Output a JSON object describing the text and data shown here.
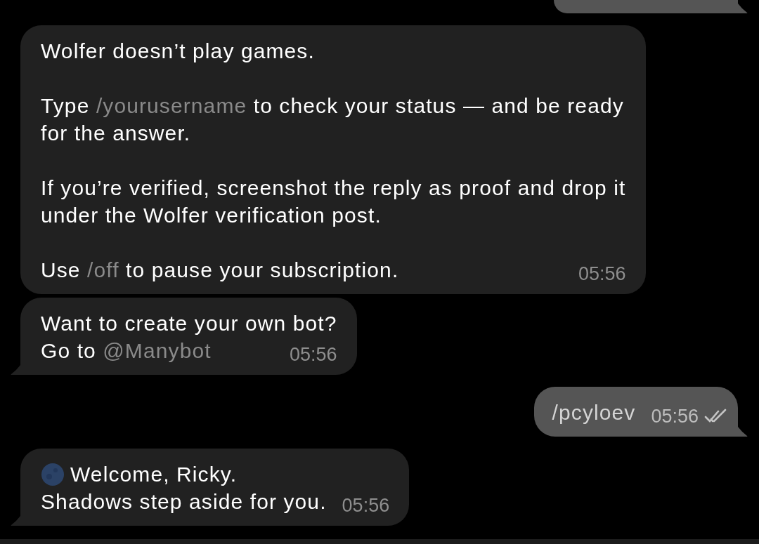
{
  "messages": [
    {
      "outgoing": true,
      "tail": true,
      "cut": true
    },
    {
      "outgoing": false,
      "tail": false,
      "time": "05:56",
      "paragraphs": [
        [
          [
            {
              "kind": "text",
              "text": "Wolfer doesn’t play games."
            }
          ]
        ],
        [
          [
            {
              "kind": "text",
              "text": "Type "
            },
            {
              "kind": "command",
              "text": "/yourusername"
            },
            {
              "kind": "text",
              "text": " to check your status — and be ready"
            }
          ],
          [
            {
              "kind": "text",
              "text": "for the answer."
            }
          ]
        ],
        [
          [
            {
              "kind": "text",
              "text": "If you’re verified, screenshot the reply as proof and drop it"
            }
          ],
          [
            {
              "kind": "text",
              "text": "under the Wolfer verification post."
            }
          ]
        ],
        [
          [
            {
              "kind": "text",
              "text": "Use "
            },
            {
              "kind": "command",
              "text": "/off"
            },
            {
              "kind": "text",
              "text": " to pause your subscription."
            }
          ]
        ]
      ]
    },
    {
      "outgoing": false,
      "tail": true,
      "time": "05:56",
      "paragraphs": [
        [
          [
            {
              "kind": "text",
              "text": "Want to create your own bot?"
            }
          ],
          [
            {
              "kind": "text",
              "text": "Go to "
            },
            {
              "kind": "command",
              "text": "@Manybot"
            }
          ]
        ]
      ]
    },
    {
      "outgoing": true,
      "tail": true,
      "time": "05:56",
      "read": true,
      "paragraphs": [
        [
          [
            {
              "kind": "text",
              "text": "/pcyloev"
            }
          ]
        ]
      ]
    },
    {
      "outgoing": false,
      "tail": true,
      "time": "05:56",
      "paragraphs": [
        [
          [
            {
              "kind": "emoji"
            },
            {
              "kind": "text",
              "text": "Welcome, Ricky."
            }
          ],
          [
            {
              "kind": "text",
              "text": "Shadows step aside for you."
            }
          ]
        ]
      ]
    }
  ]
}
